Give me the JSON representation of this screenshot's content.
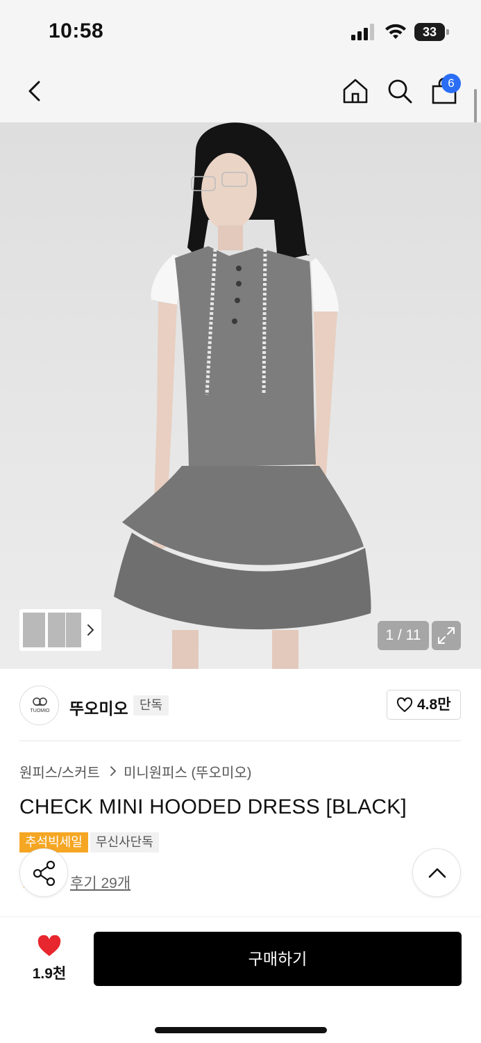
{
  "status_bar": {
    "time": "10:58",
    "battery": "33",
    "icons": [
      "cellular-signal-icon",
      "wifi-icon",
      "battery-icon"
    ]
  },
  "nav": {
    "icons": [
      "back-arrow-icon",
      "home-icon",
      "search-icon",
      "shopping-bag-icon"
    ],
    "cart_badge": "6"
  },
  "gallery": {
    "image": "model in gray check hooded mini dress",
    "counter": "1 / 11",
    "icons": [
      "chevron-right-icon",
      "expand-icon"
    ]
  },
  "brand": {
    "name": "뚜오미오",
    "logo_text": "TUOMIO",
    "exclusive_tag": "단독",
    "like_count": "4.8만"
  },
  "product": {
    "breadcrumb": [
      "원피스/스커트",
      "미니원피스 (뚜오미오)"
    ],
    "title": "CHECK MINI HOODED DRESS [BLACK]",
    "tags": [
      "추석빅세일",
      "무신사단독"
    ],
    "review_link": "후기 29개"
  },
  "bottom_bar": {
    "wish_count": "1.9천",
    "buy_label": "구매하기"
  },
  "colors": {
    "accent_blue": "#2a6ef5",
    "sale_orange": "#f5a623",
    "heart_red": "#e8262d",
    "buy_button": "#000000"
  }
}
